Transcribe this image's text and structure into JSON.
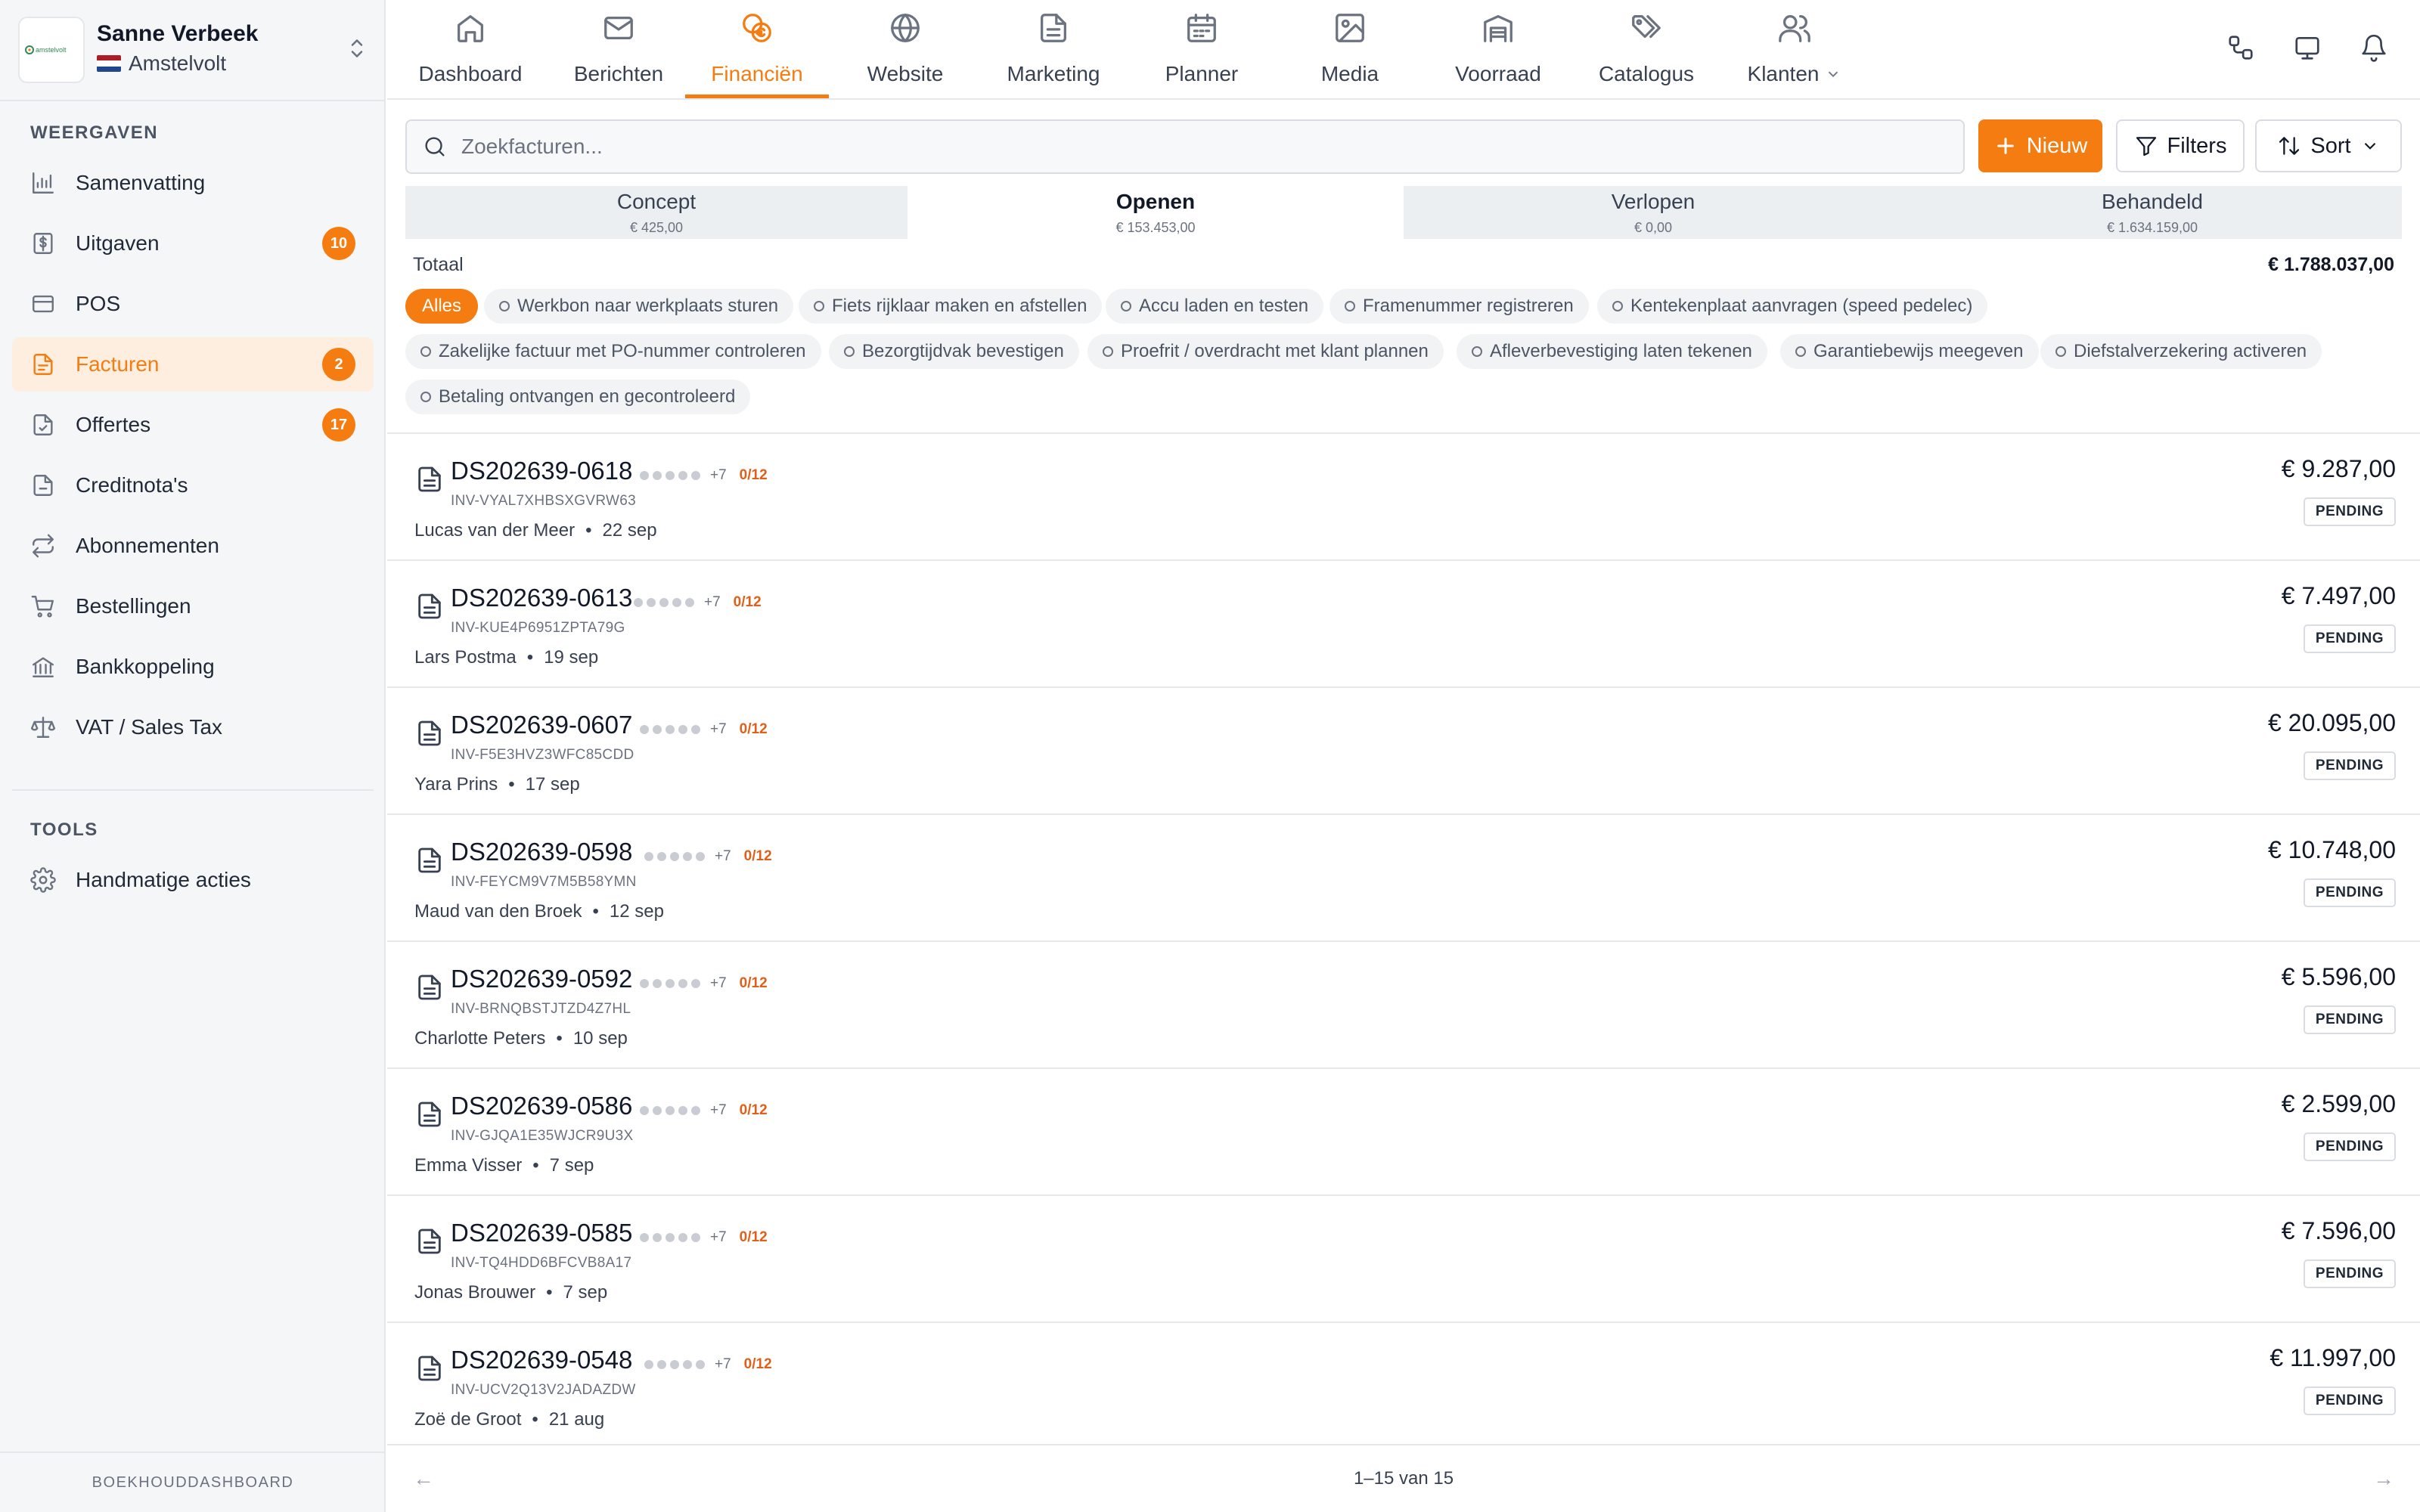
{
  "account": {
    "name": "Sanne Verbeek",
    "company": "Amstelvolt",
    "logo_text": "amstelvolt"
  },
  "sidebar": {
    "section_views": "WEERGAVEN",
    "items": [
      {
        "label": "Samenvatting",
        "icon": "bar-chart-icon",
        "badge": ""
      },
      {
        "label": "Uitgaven",
        "icon": "dollar-doc-icon",
        "badge": "10"
      },
      {
        "label": "POS",
        "icon": "credit-card-icon",
        "badge": ""
      },
      {
        "label": "Facturen",
        "icon": "invoice-icon",
        "badge": "2",
        "active": true
      },
      {
        "label": "Offertes",
        "icon": "quote-doc-icon",
        "badge": "17"
      },
      {
        "label": "Creditnota's",
        "icon": "credit-note-icon",
        "badge": ""
      },
      {
        "label": "Abonnementen",
        "icon": "repeat-icon",
        "badge": ""
      },
      {
        "label": "Bestellingen",
        "icon": "cart-icon",
        "badge": ""
      },
      {
        "label": "Bankkoppeling",
        "icon": "bank-icon",
        "badge": ""
      },
      {
        "label": "VAT / Sales Tax",
        "icon": "scale-icon",
        "badge": ""
      }
    ],
    "section_tools": "TOOLS",
    "tools": [
      {
        "label": "Handmatige acties",
        "icon": "gear-icon"
      }
    ],
    "footer": "BOEKHOUDDASHBOARD"
  },
  "topnav": {
    "tabs": [
      {
        "label": "Dashboard",
        "icon": "home-icon"
      },
      {
        "label": "Berichten",
        "icon": "mail-icon"
      },
      {
        "label": "Financiën",
        "icon": "coins-icon",
        "active": true
      },
      {
        "label": "Website",
        "icon": "globe-icon"
      },
      {
        "label": "Marketing",
        "icon": "document-icon"
      },
      {
        "label": "Planner",
        "icon": "calendar-icon"
      },
      {
        "label": "Media",
        "icon": "image-icon"
      },
      {
        "label": "Voorraad",
        "icon": "warehouse-icon"
      },
      {
        "label": "Catalogus",
        "icon": "tags-icon"
      },
      {
        "label": "Klanten",
        "icon": "users-icon",
        "dropdown": true
      }
    ]
  },
  "toolbar": {
    "search_placeholder": "Zoekfacturen...",
    "new_label": "Nieuw",
    "filters_label": "Filters",
    "sort_label": "Sort"
  },
  "status_tabs": [
    {
      "label": "Concept",
      "amount": "€ 425,00"
    },
    {
      "label": "Openen",
      "amount": "€ 153.453,00",
      "selected": true
    },
    {
      "label": "Verlopen",
      "amount": "€ 0,00"
    },
    {
      "label": "Behandeld",
      "amount": "€ 1.634.159,00"
    }
  ],
  "total": {
    "label": "Totaal",
    "value": "€ 1.788.037,00"
  },
  "chips": [
    "Alles",
    "Werkbon naar werkplaats sturen",
    "Fiets rijklaar maken en afstellen",
    "Accu laden en testen",
    "Framenummer registreren",
    "Kentekenplaat aanvragen (speed pedelec)",
    "Zakelijke factuur met PO-nummer controleren",
    "Bezorgtijdvak bevestigen",
    "Proefrit / overdracht met klant plannen",
    "Afleverbevestiging laten tekenen",
    "Garantiebewijs meegeven",
    "Diefstalverzekering activeren",
    "Betaling ontvangen en gecontroleerd"
  ],
  "invoices": [
    {
      "number": "DS202639-0618",
      "ref": "INV-VYAL7XHBSXGVRW63",
      "customer": "Lucas van der Meer",
      "date": "22 sep",
      "extra": "+7",
      "progress": "0/12",
      "amount": "€ 9.287,00",
      "status": "PENDING"
    },
    {
      "number": "DS202639-0613",
      "ref": "INV-KUE4P6951ZPTA79G",
      "customer": "Lars Postma",
      "date": "19 sep",
      "extra": "+7",
      "progress": "0/12",
      "amount": "€ 7.497,00",
      "status": "PENDING"
    },
    {
      "number": "DS202639-0607",
      "ref": "INV-F5E3HVZ3WFC85CDD",
      "customer": "Yara Prins",
      "date": "17 sep",
      "extra": "+7",
      "progress": "0/12",
      "amount": "€ 20.095,00",
      "status": "PENDING"
    },
    {
      "number": "DS202639-0598",
      "ref": "INV-FEYCM9V7M5B58YMN",
      "customer": "Maud van den Broek",
      "date": "12 sep",
      "extra": "+7",
      "progress": "0/12",
      "amount": "€ 10.748,00",
      "status": "PENDING"
    },
    {
      "number": "DS202639-0592",
      "ref": "INV-BRNQBSTJTZD4Z7HL",
      "customer": "Charlotte Peters",
      "date": "10 sep",
      "extra": "+7",
      "progress": "0/12",
      "amount": "€ 5.596,00",
      "status": "PENDING"
    },
    {
      "number": "DS202639-0586",
      "ref": "INV-GJQA1E35WJCR9U3X",
      "customer": "Emma Visser",
      "date": "7 sep",
      "extra": "+7",
      "progress": "0/12",
      "amount": "€ 2.599,00",
      "status": "PENDING"
    },
    {
      "number": "DS202639-0585",
      "ref": "INV-TQ4HDD6BFCVB8A17",
      "customer": "Jonas Brouwer",
      "date": "7 sep",
      "extra": "+7",
      "progress": "0/12",
      "amount": "€ 7.596,00",
      "status": "PENDING"
    },
    {
      "number": "DS202639-0548",
      "ref": "INV-UCV2Q13V2JADAZDW",
      "customer": "Zoë de Groot",
      "date": "21 aug",
      "extra": "+7",
      "progress": "0/12",
      "amount": "€ 11.997,00",
      "status": "PENDING"
    }
  ],
  "pagination": {
    "text": "1–15 van 15",
    "prev": "←",
    "next": "→"
  },
  "colors": {
    "accent": "#f57c10",
    "active_bg": "#fdeee0",
    "progress_red": "#e0601a"
  }
}
